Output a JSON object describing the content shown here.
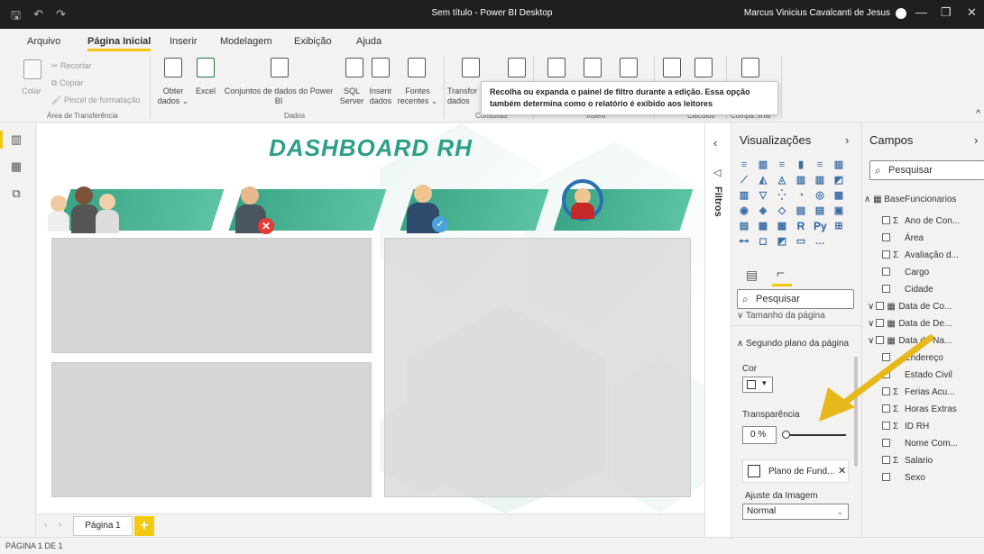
{
  "titlebar": {
    "title": "Sem título - Power BI Desktop",
    "user": "Marcus Vinicius Cavalcanti de Jesus"
  },
  "menu": {
    "tabs": [
      "Arquivo",
      "Página Inicial",
      "Inserir",
      "Modelagem",
      "Exibição",
      "Ajuda"
    ],
    "active": "Página Inicial"
  },
  "ribbon": {
    "clipboard": {
      "colar": "Colar",
      "recortar": "Recortar",
      "copiar": "Copiar",
      "pincel": "Pincel de formatação",
      "group": "Área de Transferência"
    },
    "dados": {
      "obter": "Obter",
      "obter2": "dados ⌄",
      "excel": "Excel",
      "conjuntos": "Conjuntos de dados do Power",
      "conjuntos2": "BI",
      "sql": "SQL",
      "sql2": "Server",
      "inserir": "Inserir",
      "inserir2": "dados",
      "fontes": "Fontes",
      "fontes2": "recentes ⌄",
      "group": "Dados"
    },
    "consultas": {
      "transform": "Transfor",
      "transform2": "dados",
      "group": "Consultas"
    },
    "inserir_group": "Inserir",
    "calculos_group": "Cálculos",
    "compartilhar_group": "Compa..ilhar"
  },
  "tooltip": {
    "line1": "Recolha ou expanda o painel de filtro durante a edição. Essa opção",
    "line2": "também determina como o relatório é exibido aos leitores"
  },
  "canvas": {
    "title": "DASHBOARD RH"
  },
  "pages": {
    "tab": "Página 1",
    "add": "+",
    "status": "PÁGINA 1 DE 1"
  },
  "filters": {
    "label": "Filtros"
  },
  "visualizations": {
    "title": "Visualizações",
    "search_placeholder": "Pesquisar",
    "tamanho": "Tamanho da página",
    "segundo_plano": "Segundo plano da página",
    "cor_label": "Cor",
    "transparencia_label": "Transparência",
    "transparencia_value": "0",
    "transparencia_unit": "%",
    "transparencia_level": 0,
    "plano_fundo": "Plano de Fund...",
    "ajuste_label": "Ajuste da Imagem",
    "ajuste_value": "Normal",
    "viz_icons": [
      "stacked-bar",
      "clustered-column",
      "stacked-bar-100",
      "column",
      "bar",
      "column-100",
      "line",
      "area",
      "stacked-area",
      "line-column",
      "line-clustered",
      "ribbon",
      "waterfall",
      "funnel",
      "scatter",
      "pie",
      "donut",
      "treemap",
      "map",
      "filled-map",
      "shape-map",
      "card",
      "multirow-card",
      "kpi",
      "slicer",
      "table",
      "matrix",
      "R",
      "Py",
      "key-influencers",
      "decomposition",
      "qa",
      "smart-narrative",
      "paginated",
      "more"
    ]
  },
  "fields": {
    "title": "Campos",
    "search_placeholder": "Pesquisar",
    "table": "BaseFuncionarios",
    "items": [
      {
        "label": "Ano de Con...",
        "sigma": true,
        "expand": false
      },
      {
        "label": "Área",
        "sigma": false,
        "expand": false
      },
      {
        "label": "Avaliação d...",
        "sigma": true,
        "expand": false
      },
      {
        "label": "Cargo",
        "sigma": false,
        "expand": false
      },
      {
        "label": "Cidade",
        "sigma": false,
        "expand": false
      },
      {
        "label": "Data de Co...",
        "sigma": false,
        "expand": true
      },
      {
        "label": "Data de De...",
        "sigma": false,
        "expand": true
      },
      {
        "label": "Data de Na...",
        "sigma": false,
        "expand": true
      },
      {
        "label": "Endereço",
        "sigma": false,
        "expand": false
      },
      {
        "label": "Estado Civil",
        "sigma": false,
        "expand": false
      },
      {
        "label": "Ferias Acu...",
        "sigma": true,
        "expand": false
      },
      {
        "label": "Horas Extras",
        "sigma": true,
        "expand": false
      },
      {
        "label": "ID RH",
        "sigma": true,
        "expand": false
      },
      {
        "label": "Nome Com...",
        "sigma": false,
        "expand": false
      },
      {
        "label": "Salario",
        "sigma": true,
        "expand": false
      },
      {
        "label": "Sexo",
        "sigma": false,
        "expand": false
      }
    ]
  },
  "colors": {
    "accent": "#f2c811",
    "teal": "#3aa586",
    "arrow": "#e6b81c"
  }
}
